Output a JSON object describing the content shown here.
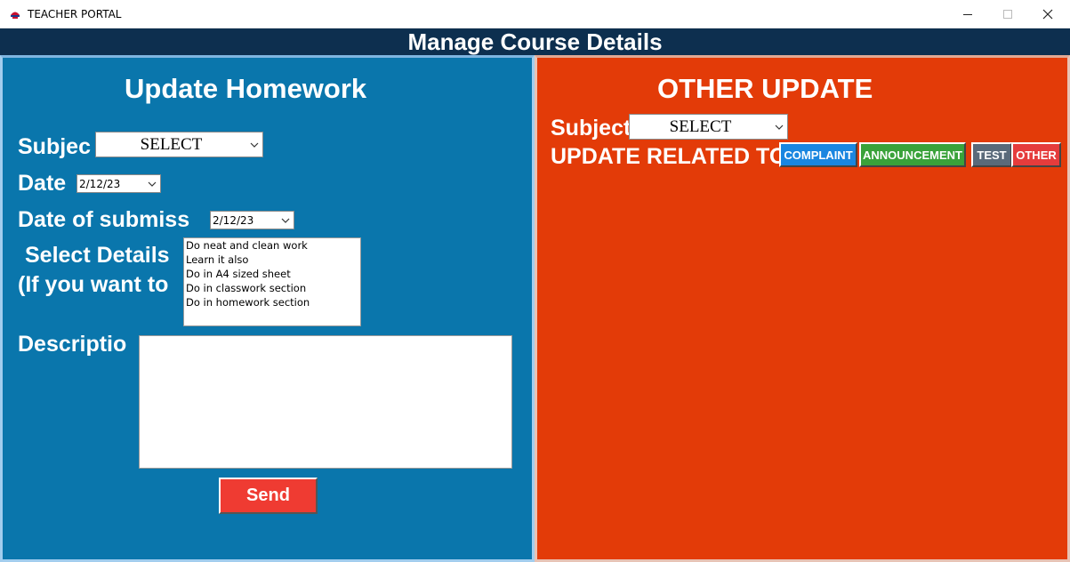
{
  "window": {
    "title": "TEACHER PORTAL",
    "icon": "app-logo-icon",
    "controls": [
      "minimize",
      "maximize",
      "close"
    ]
  },
  "header": {
    "title": "Manage Course Details",
    "color": "#0d2f4f"
  },
  "homework": {
    "title": "Update Homework",
    "panel_color": "#0a76ac",
    "subject_label": "Subjec",
    "subject_value": "SELECT",
    "date_label": "Date",
    "date_value": "2/12/23",
    "submission_label": "Date of submiss",
    "submission_value": "2/12/23",
    "details_label_line1": "Select Details",
    "details_label_line2": "(If you want to",
    "details_options": [
      "Do neat and clean work",
      "Learn it also",
      "Do in A4 sized sheet",
      "Do in classwork section",
      "Do in homework section"
    ],
    "description_label": "Descriptio",
    "description_value": "",
    "send_label": "Send"
  },
  "other": {
    "title": "OTHER UPDATE",
    "panel_color": "#e33b08",
    "subject_label": "Subject",
    "subject_value": "SELECT",
    "related_label": "UPDATE RELATED TO",
    "buttons": {
      "complaint": {
        "label": "COMPLAINT",
        "color": "#1a86e0"
      },
      "announcement": {
        "label": "ANNOUNCEMENT",
        "color": "#3aa23a"
      },
      "test": {
        "label": "TEST",
        "color": "#5a6a7a"
      },
      "other": {
        "label": "OTHER",
        "color": "#e53c3c"
      }
    }
  }
}
